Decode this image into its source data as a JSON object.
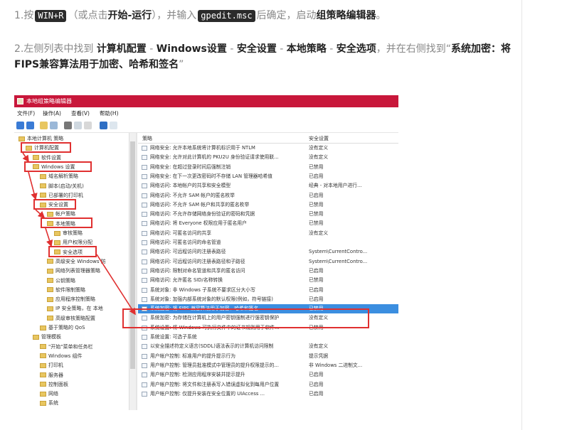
{
  "step1": {
    "prefix": "1.按",
    "key": "WIN+R",
    "mid1": "（或点击",
    "bold1": "开始-运行",
    "mid2": "），并输入",
    "cmd": "gpedit.msc",
    "mid3": "后确定，启动",
    "bold2": "组策略编辑器",
    "end": "。"
  },
  "step2": {
    "prefix": "2.左侧列表中找到",
    "path1": "计算机配置",
    "sep1": " - ",
    "path2": "Windows设置",
    "sep2": " - ",
    "path3": "安全设置",
    "sep3": " - ",
    "path4": "本地策略",
    "sep4": " - ",
    "path5": "安全选项",
    "mid": "，并在右侧找到“",
    "target": "系统加密：将FIPS兼容算法用于加密、哈希和签名",
    "end": "”"
  },
  "gpedit": {
    "title": "本地组策略编辑器",
    "menu": [
      "文件(F)",
      "操作(A)",
      "查看(V)",
      "帮助(H)"
    ],
    "tree": [
      {
        "label": "本地计算机 策略",
        "level": 0
      },
      {
        "label": "计算机配置",
        "level": 1
      },
      {
        "label": "软件设置",
        "level": 2
      },
      {
        "label": "Windows 设置",
        "level": 2
      },
      {
        "label": "域名解析策略",
        "level": 3
      },
      {
        "label": "脚本(启动/关机)",
        "level": 3
      },
      {
        "label": "已部署的打印机",
        "level": 3
      },
      {
        "label": "安全设置",
        "level": 3
      },
      {
        "label": "帐户策略",
        "level": 4
      },
      {
        "label": "本地策略",
        "level": 4
      },
      {
        "label": "审核策略",
        "level": 5
      },
      {
        "label": "用户权限分配",
        "level": 5
      },
      {
        "label": "安全选项",
        "level": 5
      },
      {
        "label": "高级安全 Windows 防",
        "level": 4
      },
      {
        "label": "网络列表管理器策略",
        "level": 4
      },
      {
        "label": "公钥策略",
        "level": 4
      },
      {
        "label": "软件限制策略",
        "level": 4
      },
      {
        "label": "应用程序控制策略",
        "level": 4
      },
      {
        "label": "IP 安全策略，在 本地",
        "level": 4
      },
      {
        "label": "高级审核策略配置",
        "level": 4
      },
      {
        "label": "基于策略的 QoS",
        "level": 3
      },
      {
        "label": "管理模板",
        "level": 2
      },
      {
        "label": "\"开始\"菜单和任务栏",
        "level": 3
      },
      {
        "label": "Windows 组件",
        "level": 3
      },
      {
        "label": "打印机",
        "level": 3
      },
      {
        "label": "服务器",
        "level": 3
      },
      {
        "label": "控制面板",
        "level": 3
      },
      {
        "label": "网络",
        "level": 3
      },
      {
        "label": "系统",
        "level": 3
      }
    ],
    "columns": {
      "policy": "策略",
      "setting": "安全设置"
    },
    "policies": [
      {
        "name": "网络安全: 允许本地系统将计算机标识用于 NTLM",
        "setting": "没有定义"
      },
      {
        "name": "网络安全: 允许对此计算机的 PKU2U 身份验证请求使用联...",
        "setting": "没有定义"
      },
      {
        "name": "网络安全: 在超过登录时间后强制注销",
        "setting": "已禁用"
      },
      {
        "name": "网络安全: 在下一次更改密码时不存储 LAN 管理器哈希值",
        "setting": "已启用"
      },
      {
        "name": "网络访问: 本地帐户的共享和安全模型",
        "setting": "经典 - 对本地用户进行..."
      },
      {
        "name": "网络访问: 不允许 SAM 帐户的匿名枚举",
        "setting": "已启用"
      },
      {
        "name": "网络访问: 不允许 SAM 帐户和共享的匿名枚举",
        "setting": "已禁用"
      },
      {
        "name": "网络访问: 不允许存储网络身份验证的密码和凭据",
        "setting": "已禁用"
      },
      {
        "name": "网络访问: 将 Everyone 权限应用于匿名用户",
        "setting": "已禁用"
      },
      {
        "name": "网络访问: 可匿名访问的共享",
        "setting": "没有定义"
      },
      {
        "name": "网络访问: 可匿名访问的命名管道",
        "setting": ""
      },
      {
        "name": "网络访问: 可远程访问的注册表路径",
        "setting": "System\\CurrentContro..."
      },
      {
        "name": "网络访问: 可远程访问的注册表路径和子路径",
        "setting": "System\\CurrentContro..."
      },
      {
        "name": "网络访问: 限制对命名管道和共享的匿名访问",
        "setting": "已启用"
      },
      {
        "name": "网络访问: 允许匿名 SID/名称转换",
        "setting": "已禁用"
      },
      {
        "name": "系统对象: 非 Windows 子系统不要求区分大小写",
        "setting": "已启用"
      },
      {
        "name": "系统对象: 加强内部系统对象的默认权限(例如，符号链接)",
        "setting": "已启用"
      },
      {
        "name": "系统加密: 将 FIPS 兼容算法用于加密、哈希和签名",
        "setting": "已禁用",
        "selected": true
      },
      {
        "name": "系统加密: 为存储在计算机上的用户密钥强制进行强密钥保护",
        "setting": "没有定义"
      },
      {
        "name": "系统设置: 将 Windows 可执行文件中的证书规则用于软件...",
        "setting": "已禁用"
      },
      {
        "name": "系统设置: 可选子系统",
        "setting": ""
      },
      {
        "name": "以安全描述符定义语言(SDDL)语法表示的计算机访问限制",
        "setting": "没有定义"
      },
      {
        "name": "用户帐户控制: 标准用户的提升提示行为",
        "setting": "提示凭据"
      },
      {
        "name": "用户帐户控制: 管理员批准模式中管理员的提升权限提示的...",
        "setting": "非 Windows 二进制文..."
      },
      {
        "name": "用户帐户控制: 检测应用程序安装并提示提升",
        "setting": "已启用"
      },
      {
        "name": "用户帐户控制: 将文件和注册表写入错误虚拟化到每用户位置",
        "setting": "已启用"
      },
      {
        "name": "用户帐户控制: 仅提升安装在安全位置的 UIAccess ...",
        "setting": "已启用"
      }
    ]
  }
}
